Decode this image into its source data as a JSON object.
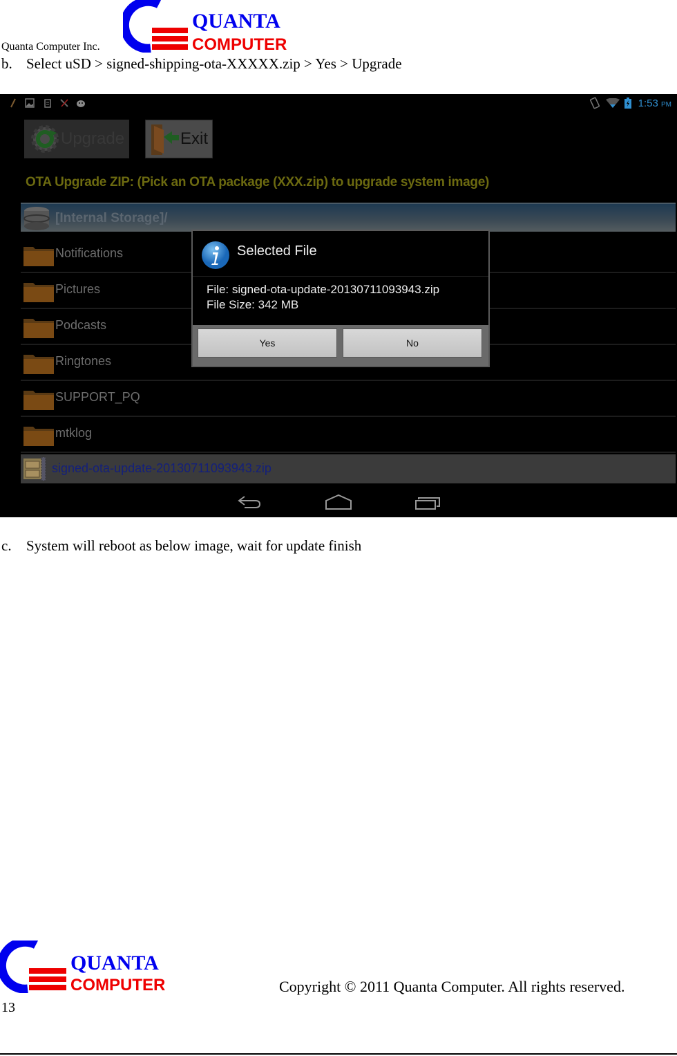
{
  "header": {
    "company": "Quanta Computer Inc.",
    "logo": {
      "line1": "QUANTA",
      "line2": "COMPUTER",
      "colors": {
        "blue": "#0000ee",
        "red": "#ee0000"
      }
    }
  },
  "steps": {
    "b": {
      "label": "b.",
      "text": "Select uSD > signed-shipping-ota-XXXXX.zip > Yes > Upgrade"
    },
    "c": {
      "label": "c.",
      "text": "System will reboot as below image, wait for update finish"
    }
  },
  "screenshot": {
    "status_bar": {
      "left_icons": [
        "pencil-icon",
        "gallery-icon",
        "clipboard-icon",
        "missed-call-icon",
        "android-debug-icon"
      ],
      "right_icons": [
        "rotation-lock-icon",
        "wifi-icon",
        "battery-charging-icon"
      ],
      "time": "1:53",
      "ampm": "PM"
    },
    "toolbar": {
      "upgrade_label": "Upgrade",
      "exit_label": "Exit"
    },
    "ota_title": "OTA Upgrade ZIP: (Pick an OTA package (XXX.zip) to upgrade system image)",
    "path": "[Internal Storage]/",
    "folders": [
      "Notifications",
      "Pictures",
      "Podcasts",
      "Ringtones",
      "SUPPORT_PQ",
      "mtklog"
    ],
    "zip_file": "signed-ota-update-20130711093943.zip",
    "dialog": {
      "title": "Selected File",
      "file_line": "File: signed-ota-update-20130711093943.zip",
      "size_line": "File Size: 342 MB",
      "yes_label": "Yes",
      "no_label": "No"
    },
    "nav": [
      "back-icon",
      "home-icon",
      "recent-apps-icon"
    ]
  },
  "footer": {
    "copyright": "Copyright © 2011 Quanta Computer. All rights reserved.",
    "page_number": "13"
  }
}
